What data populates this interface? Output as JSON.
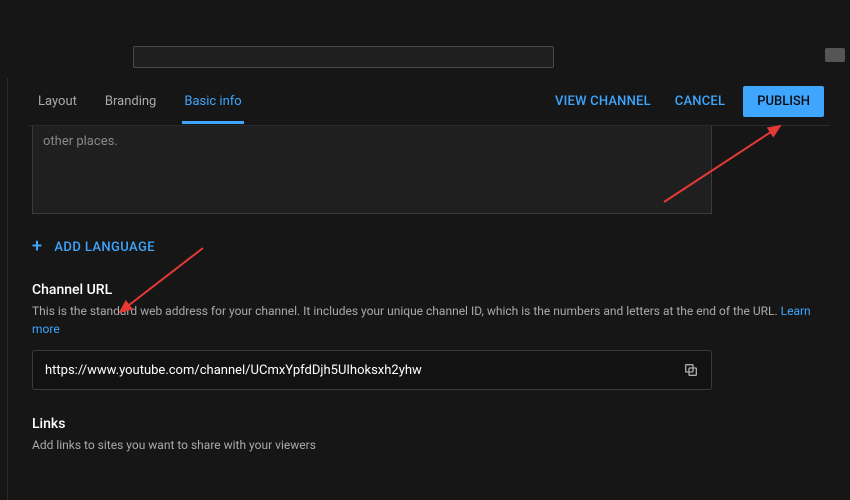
{
  "tabs": {
    "layout": "Layout",
    "branding": "Branding",
    "basic_info": "Basic info"
  },
  "actions": {
    "view_channel": "VIEW CHANNEL",
    "cancel": "CANCEL",
    "publish": "PUBLISH"
  },
  "description_box": {
    "trailing_text": "other places."
  },
  "add_language": {
    "label": "ADD LANGUAGE"
  },
  "channel_url": {
    "title": "Channel URL",
    "desc_prefix": "This is the standard web address for your channel. It includes your unique channel ID, which is the numbers and letters at the end of the URL. ",
    "learn_more": "Learn more",
    "value": "https://www.youtube.com/channel/UCmxYpfdDjh5UIhoksxh2yhw"
  },
  "links": {
    "title": "Links",
    "desc": "Add links to sites you want to share with your viewers"
  }
}
